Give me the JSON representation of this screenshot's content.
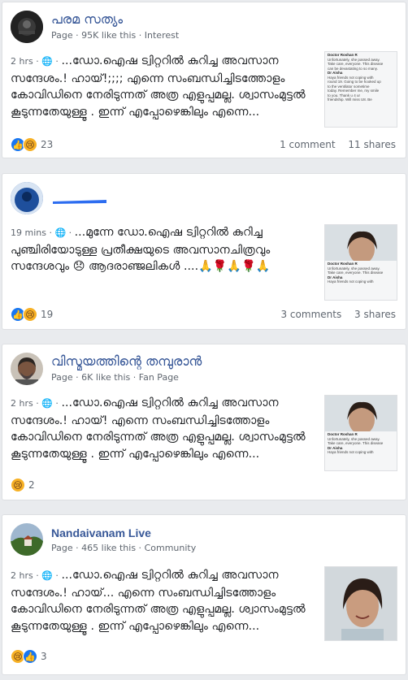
{
  "posts": [
    {
      "page_name": "പരമ സത്യം",
      "meta_type": "Page",
      "meta_likes": "95K like this",
      "meta_category": "Interest",
      "time": "2 hrs",
      "text": "...ഡോ.ഐഷ ട്വിറ്ററിൽ കുറിച്ച അവസാന സന്ദേശം.! ഹായ്!;;;; എന്നെ സംബന്ധിച്ചിടത്തോളം കോവിഡിനെ നേരിടുന്നത് അത്ര എളുപ്പമല്ല. ശ്വാസംമുട്ടൽ കൂടുന്നതേയുള്ളൂ . ഇന്ന് എപ്പോഴെങ്കിലും എന്നെ...",
      "reaction_count": "23",
      "comments": "1 comment",
      "shares": "11 shares"
    },
    {
      "page_name": "",
      "time": "19 mins",
      "text": "...മുന്നേ ഡോ.ഐഷ ട്വിറ്ററിൽ കുറിച്ച പുഞ്ചിരിയോടുള്ള പ്രതീക്ഷയുടെ അവസാനചിത്രവും സന്ദേശവും 😞 ആദരാഞ്ജലികൾ ....🙏🌹🙏🌹🙏",
      "reaction_count": "19",
      "comments": "3 comments",
      "shares": "3 shares"
    },
    {
      "page_name": "വിസ്മയത്തിന്റെ തമ്പുരാൻ",
      "meta_type": "Page",
      "meta_likes": "6K like this",
      "meta_category": "Fan Page",
      "time": "2 hrs",
      "text": "...ഡോ.ഐഷ ട്വിറ്ററിൽ കുറിച്ച അവസാന സന്ദേശം.! ഹായ്! എന്നെ സംബന്ധിച്ചിടത്തോളം കോവിഡിനെ നേരിടുന്നത് അത്ര എളുപ്പമല്ല. ശ്വാസംമുട്ടൽ കൂടുന്നതേയുള്ളൂ . ഇന്ന് എപ്പോഴെങ്കിലും എന്നെ...",
      "reaction_count": "2"
    },
    {
      "page_name": "Nandaivanam Live",
      "meta_type": "Page",
      "meta_likes": "465 like this",
      "meta_category": "Community",
      "time": "2 hrs",
      "text": "...ഡോ.ഐഷ ട്വിറ്ററിൽ കുറിച്ച അവസാന സന്ദേശം.! ഹായ്... എന്നെ സംബന്ധിച്ചിടത്തോളം കോവിഡിനെ നേരിടുന്നത് അത്ര എളുപ്പമല്ല. ശ്വാസംമുട്ടൽ കൂടുന്നതേയുള്ളൂ . ഇന്ന് എപ്പോഴെങ്കിലും എന്നെ...",
      "reaction_count": "3"
    }
  ],
  "tweet": {
    "author": "Doctor Roshan R",
    "line1": "Unfortunately, she passed away.",
    "line2": "Take care, everyone. This disease",
    "line3": "can be devastating to so many.",
    "quoted_author": "Dr Aisha",
    "q1": "Haya friends not coping with",
    "q2": "round 19. Going to be hooked up",
    "q3": "to the ventilator sometime",
    "q4": "today. Remember me, my smile",
    "q5": "to you. Thank u 4 ur",
    "q6": "friendship. Will miss U8. Be",
    "q7": "safe take this deadly virus",
    "q8": "seriously. Luv u guys. Bye."
  },
  "icons": {
    "like": "like-icon",
    "sad": "sad-icon",
    "globe": "globe-icon"
  },
  "colors": {
    "link": "#385898",
    "like_blue": "#1877f2",
    "sad_yellow": "#f7b125"
  }
}
